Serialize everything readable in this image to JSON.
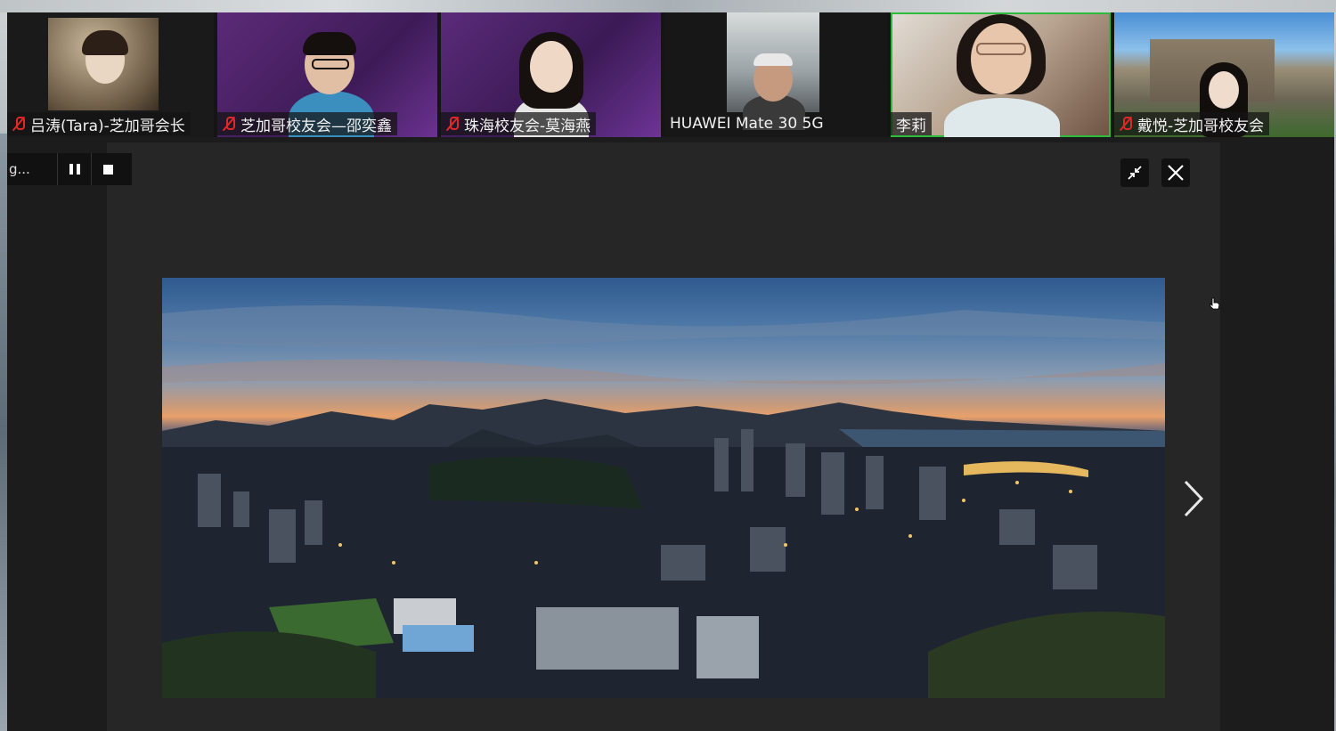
{
  "participants": [
    {
      "name": "吕涛(Tara)-芝加哥会长",
      "muted": true
    },
    {
      "name": "芝加哥校友会—邵奕鑫",
      "muted": true
    },
    {
      "name": "珠海校友会-莫海燕",
      "muted": true
    },
    {
      "name": "HUAWEI Mate 30 5G",
      "muted": false
    },
    {
      "name": "李莉",
      "muted": false,
      "active_speaker": true
    },
    {
      "name": "戴悦-芝加哥校友会",
      "muted": true
    }
  ],
  "recording": {
    "label": "g...",
    "pause_icon": "pause-icon",
    "stop_icon": "stop-icon"
  },
  "share": {
    "exit_fullscreen_icon": "collapse-icon",
    "close_icon": "close-icon",
    "next_icon": "chevron-right-icon"
  },
  "colors": {
    "active_speaker_border": "#2eba3c",
    "mute_red": "#e02828",
    "window_bg": "#1c1c1c",
    "share_bg": "#262626"
  }
}
